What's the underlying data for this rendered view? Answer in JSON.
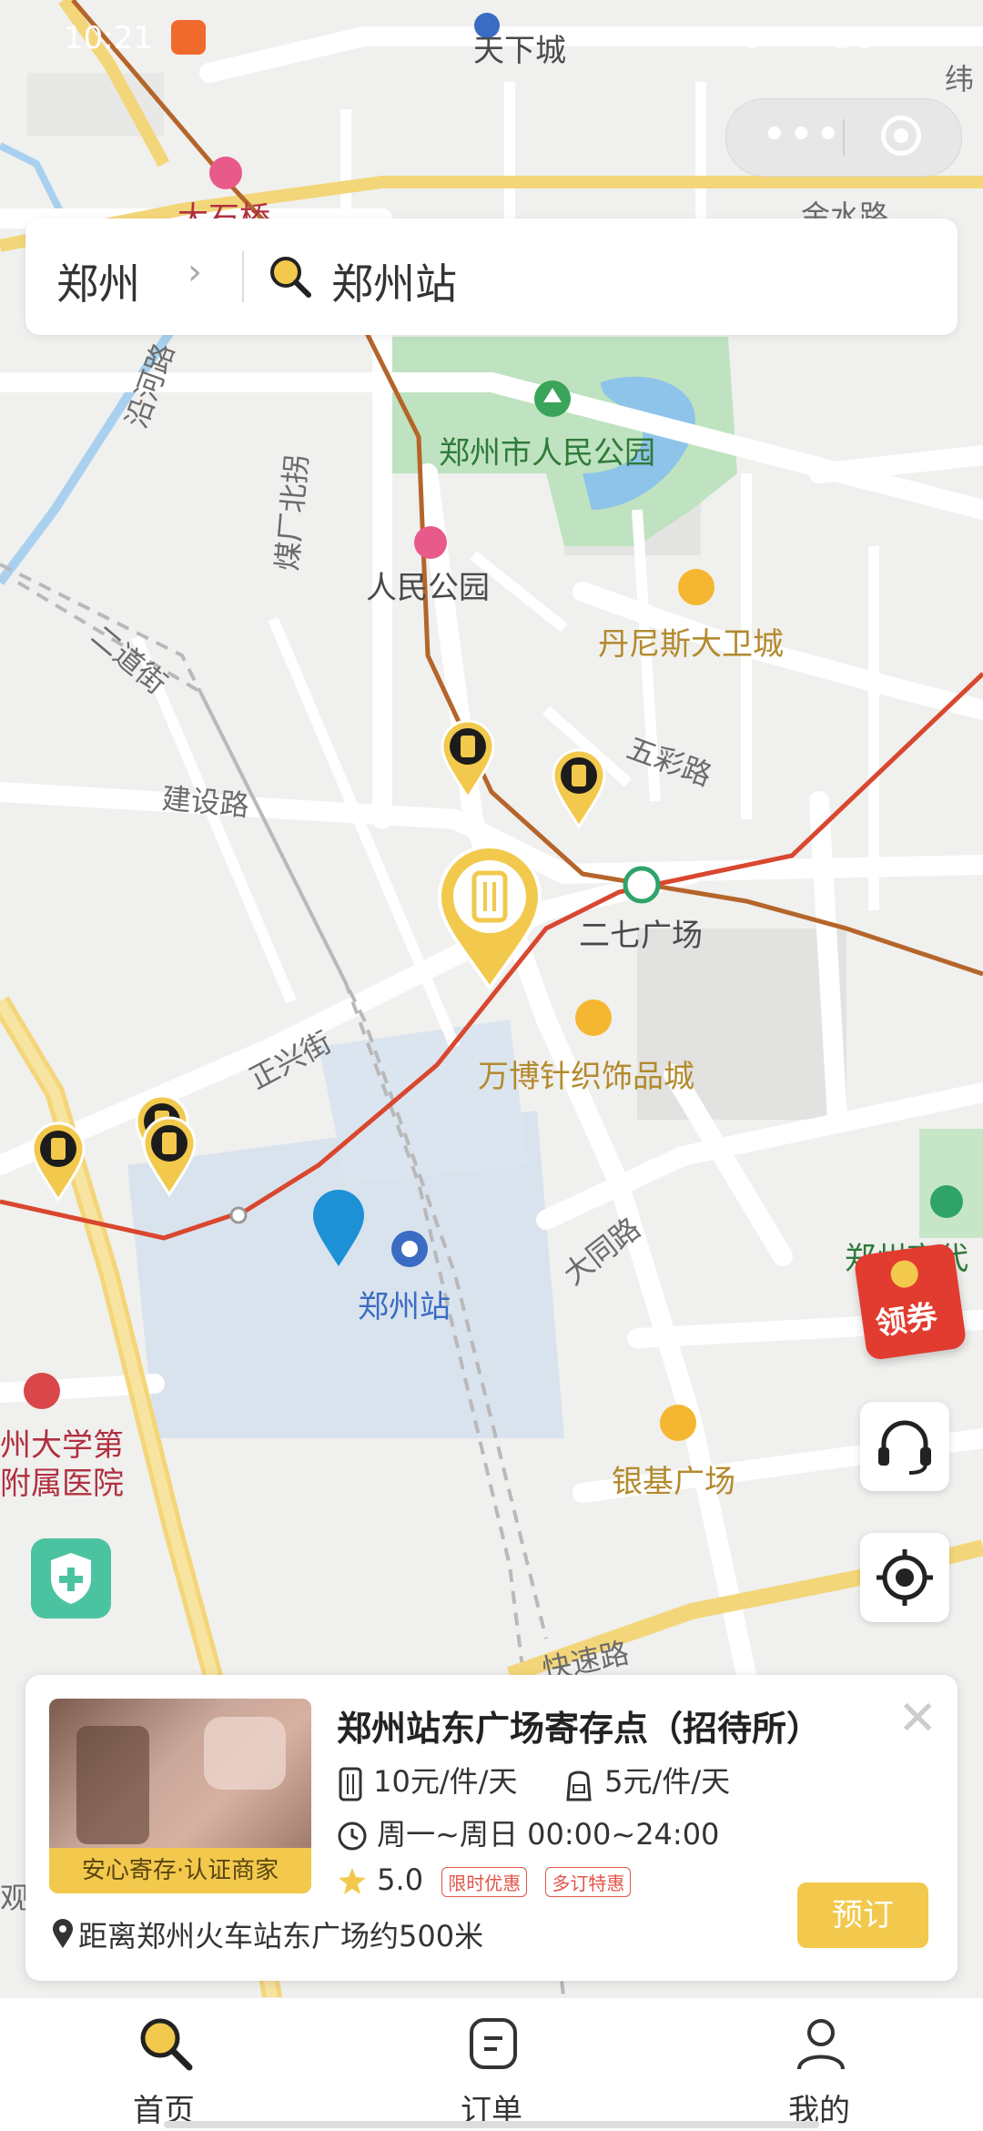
{
  "status_bar": {
    "time": "10:21",
    "icons": "◉ ◠ ▮▮ ▭"
  },
  "search": {
    "city": "郑州",
    "query": "郑州站"
  },
  "map": {
    "labels": {
      "tianxiacheng": "天下城",
      "dashiqiao": "大石桥",
      "jinshuilu": "金水路",
      "wei": "纬",
      "yanhelu": "沿河路",
      "meichangbeiguai": "煤厂北拐",
      "zhengzhou_park": "郑州市人民公园",
      "renmin_park": "人民公园",
      "dennis": "丹尼斯大卫城",
      "erdaojie": "二道街",
      "wucailu": "五彩路",
      "jiansheli": "建设路",
      "erqi_square": "二七广场",
      "zhengxingjie": "正兴街",
      "wanbo": "万博针织饰品城",
      "datonglu": "大同路",
      "zhengzhou_station": "郑州站",
      "zhengzhou_modern": "郑州商代",
      "hospital1": "州大学第",
      "hospital2": "附属医院",
      "yinji": "银基广场",
      "kuaisulu": "快速路",
      "shi": "观"
    }
  },
  "coupon": {
    "label": "领券"
  },
  "card": {
    "title": "郑州站东广场寄存点（招待所）",
    "badge": "安心寄存·认证商家",
    "luggage_price": "10元/件/天",
    "bag_price": "5元/件/天",
    "hours": "周一~周日 00:00~24:00",
    "rating": "5.0",
    "tag1": "限时优惠",
    "tag2": "多订特惠",
    "distance": "距离郑州火车站东广场约500米",
    "book_label": "预订"
  },
  "tabs": [
    {
      "label": "首页"
    },
    {
      "label": "订单"
    },
    {
      "label": "我的"
    }
  ],
  "colors": {
    "accent": "#f2c94c",
    "metro_red": "#d9472f",
    "metro_brown": "#b5652a"
  }
}
